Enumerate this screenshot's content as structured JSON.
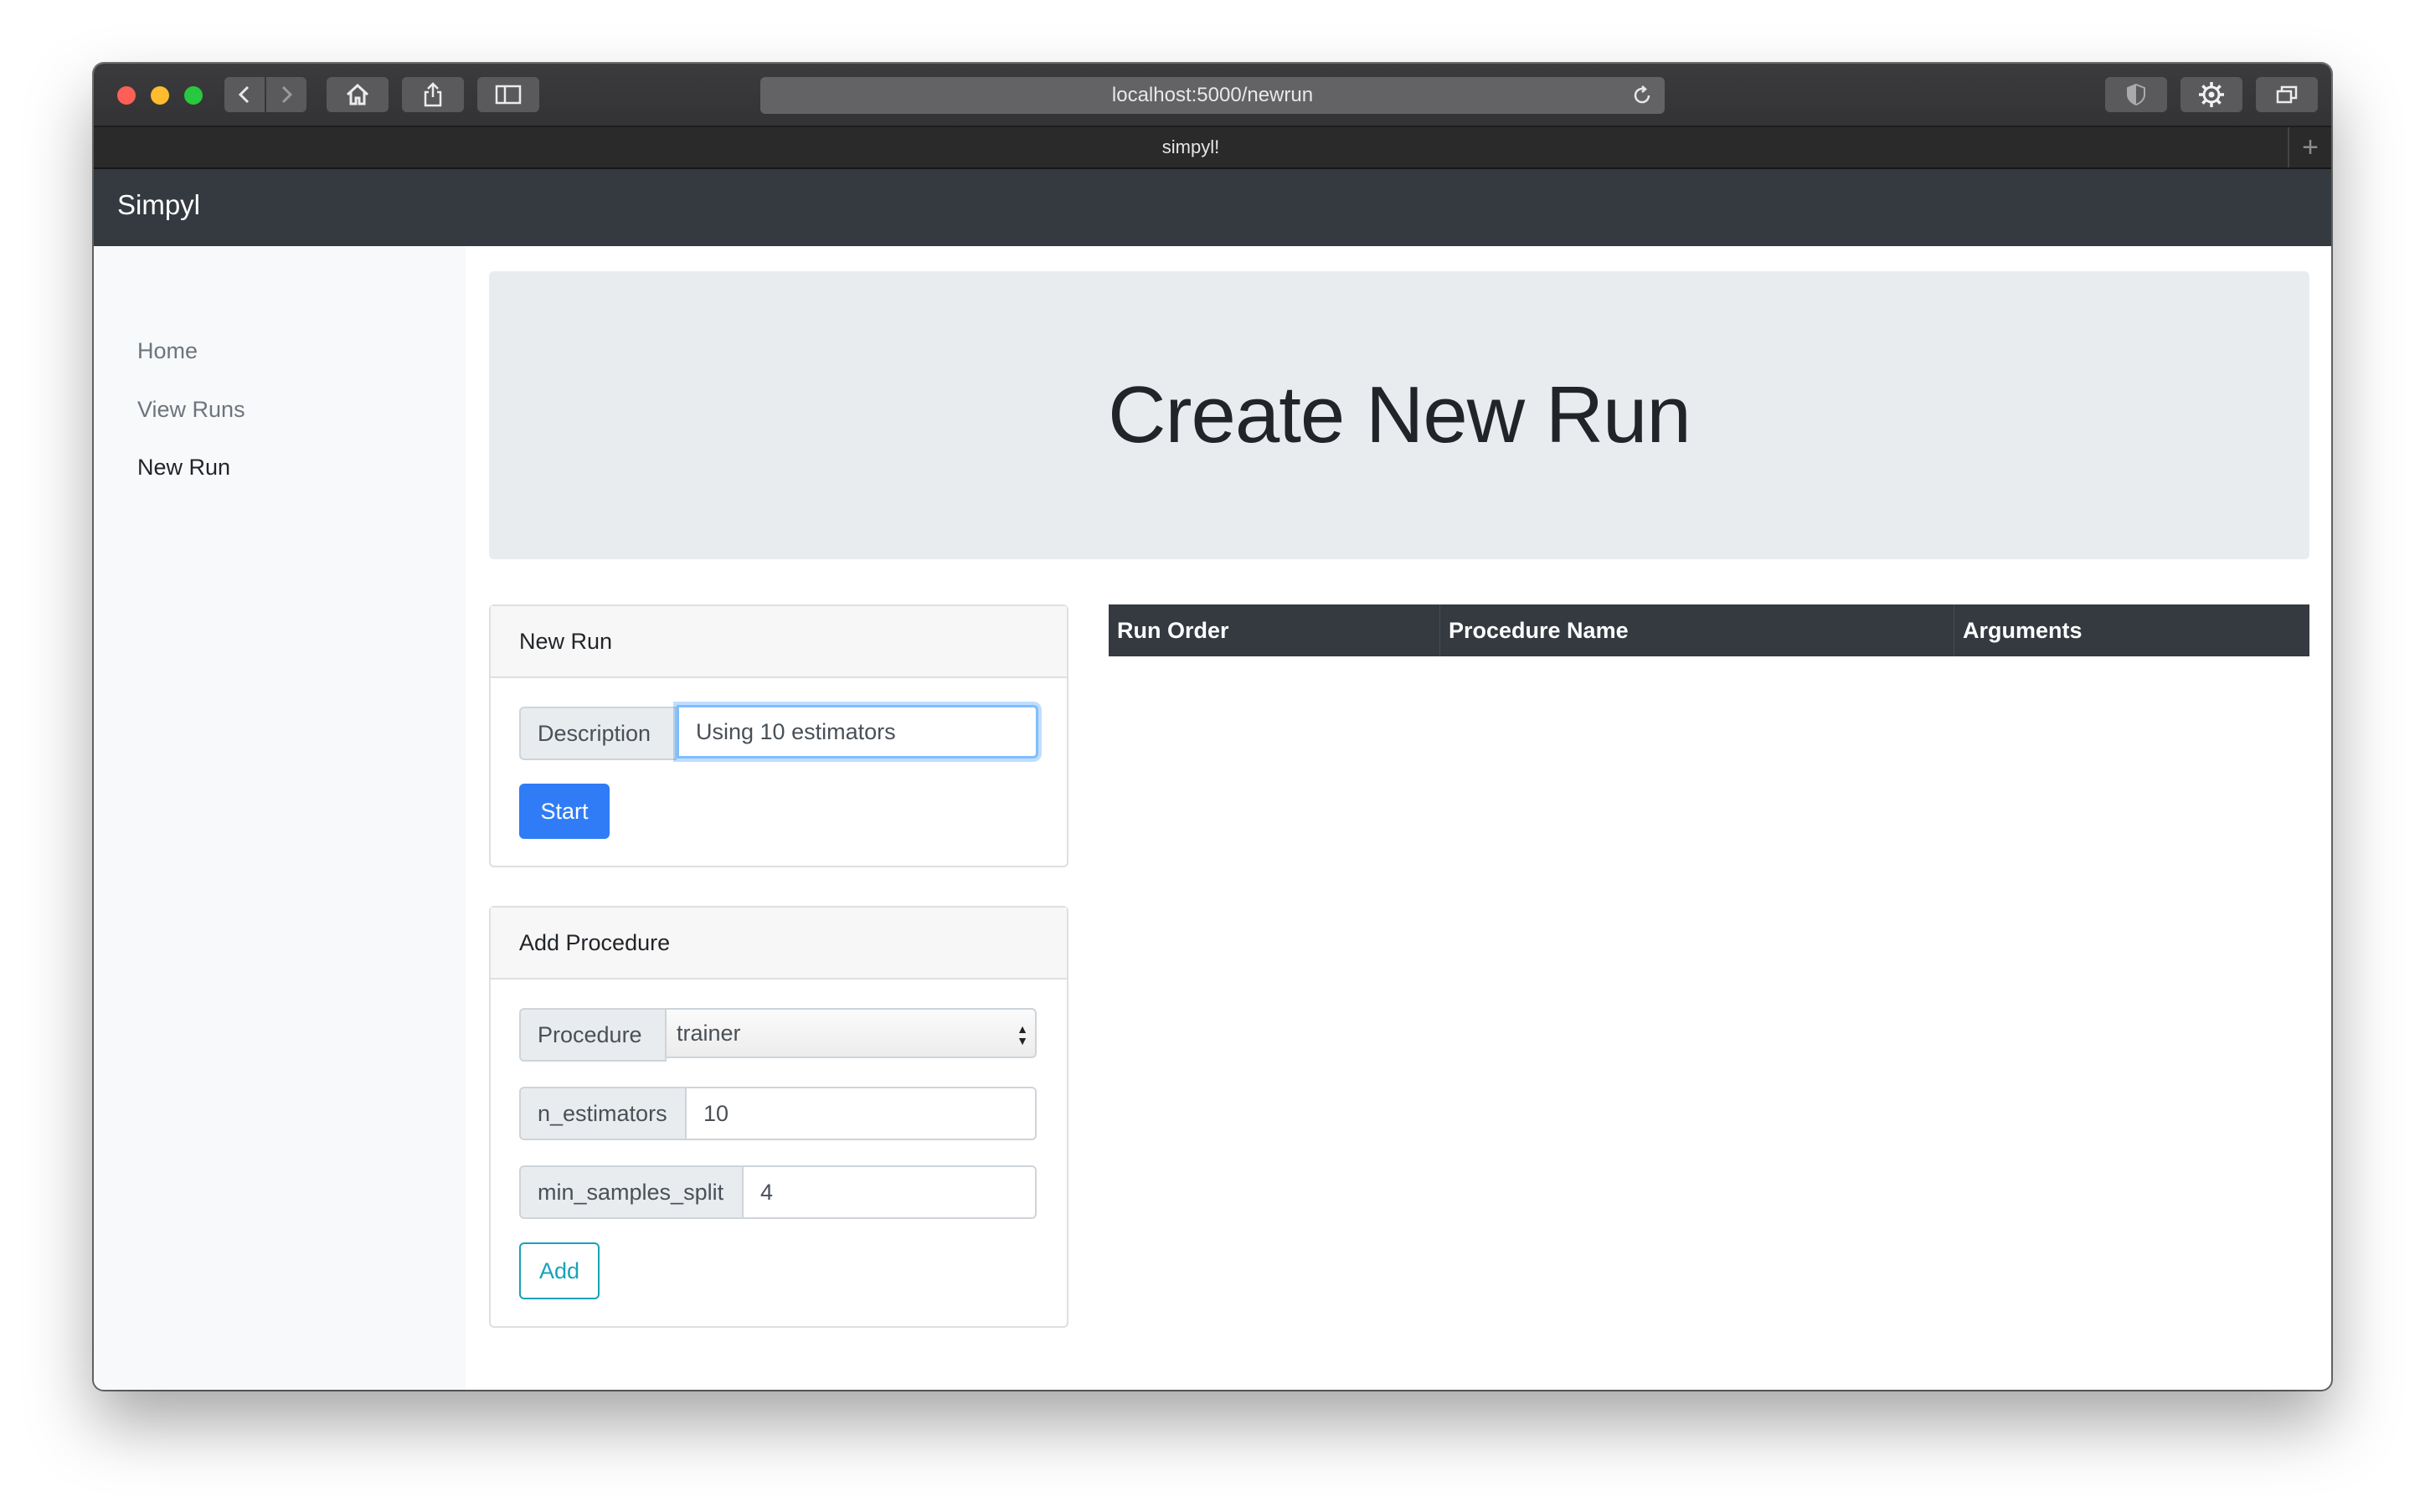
{
  "browser": {
    "url": "localhost:5000/newrun",
    "tab_title": "simpyl!",
    "new_tab_symbol": "+"
  },
  "navbar": {
    "brand": "Simpyl"
  },
  "sidebar": {
    "items": [
      {
        "label": "Home",
        "active": false
      },
      {
        "label": "View Runs",
        "active": false
      },
      {
        "label": "New Run",
        "active": true
      }
    ]
  },
  "jumbotron": {
    "title": "Create New Run"
  },
  "new_run_card": {
    "header": "New Run",
    "description_label": "Description",
    "description_value": "Using 10 estimators",
    "start_label": "Start"
  },
  "add_procedure_card": {
    "header": "Add Procedure",
    "procedure_label": "Procedure",
    "procedure_value": "trainer",
    "params": [
      {
        "label": "n_estimators",
        "value": "10"
      },
      {
        "label": "min_samples_split",
        "value": "4"
      }
    ],
    "add_label": "Add"
  },
  "run_table": {
    "columns": [
      "Run Order",
      "Procedure Name",
      "Arguments"
    ]
  },
  "colors": {
    "navbar": "#343a40",
    "primary": "#2f7cf6",
    "info": "#17a2b8",
    "jumbotron": "#e9ecef"
  }
}
